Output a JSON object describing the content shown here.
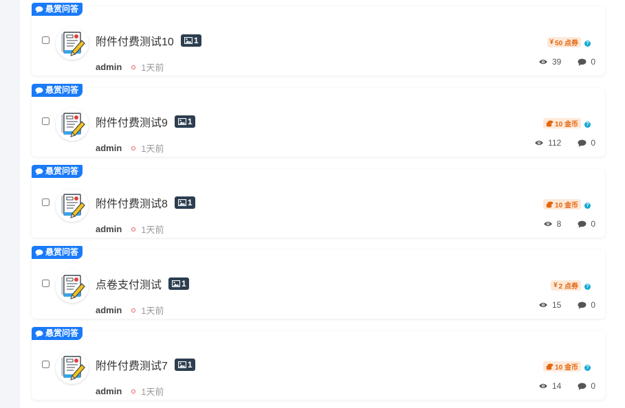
{
  "badge_label": "悬赏问答",
  "posts": [
    {
      "title": "附件付费测试10",
      "images": "1",
      "author": "admin",
      "time": "1天前",
      "reward_symbol": "¥",
      "reward": "50 点券",
      "reward_type": "cash",
      "views": "39",
      "comments": "0"
    },
    {
      "title": "附件付费测试9",
      "images": "1",
      "author": "admin",
      "time": "1天前",
      "reward_symbol": "",
      "reward": "10 金币",
      "reward_type": "coin",
      "views": "112",
      "comments": "0"
    },
    {
      "title": "附件付费测试8",
      "images": "1",
      "author": "admin",
      "time": "1天前",
      "reward_symbol": "",
      "reward": "10 金币",
      "reward_type": "coin",
      "views": "8",
      "comments": "0"
    },
    {
      "title": "点卷支付测试",
      "images": "1",
      "author": "admin",
      "time": "1天前",
      "reward_symbol": "¥",
      "reward": "2 点券",
      "reward_type": "cash",
      "views": "15",
      "comments": "0"
    },
    {
      "title": "附件付费测试7",
      "images": "1",
      "author": "admin",
      "time": "1天前",
      "reward_symbol": "",
      "reward": "10 金币",
      "reward_type": "coin",
      "views": "14",
      "comments": "0"
    }
  ],
  "colors": {
    "badge": "#1a7af8",
    "reward_bg": "#fde9d9",
    "reward_text": "#e3660f",
    "help": "#14a9d6"
  }
}
